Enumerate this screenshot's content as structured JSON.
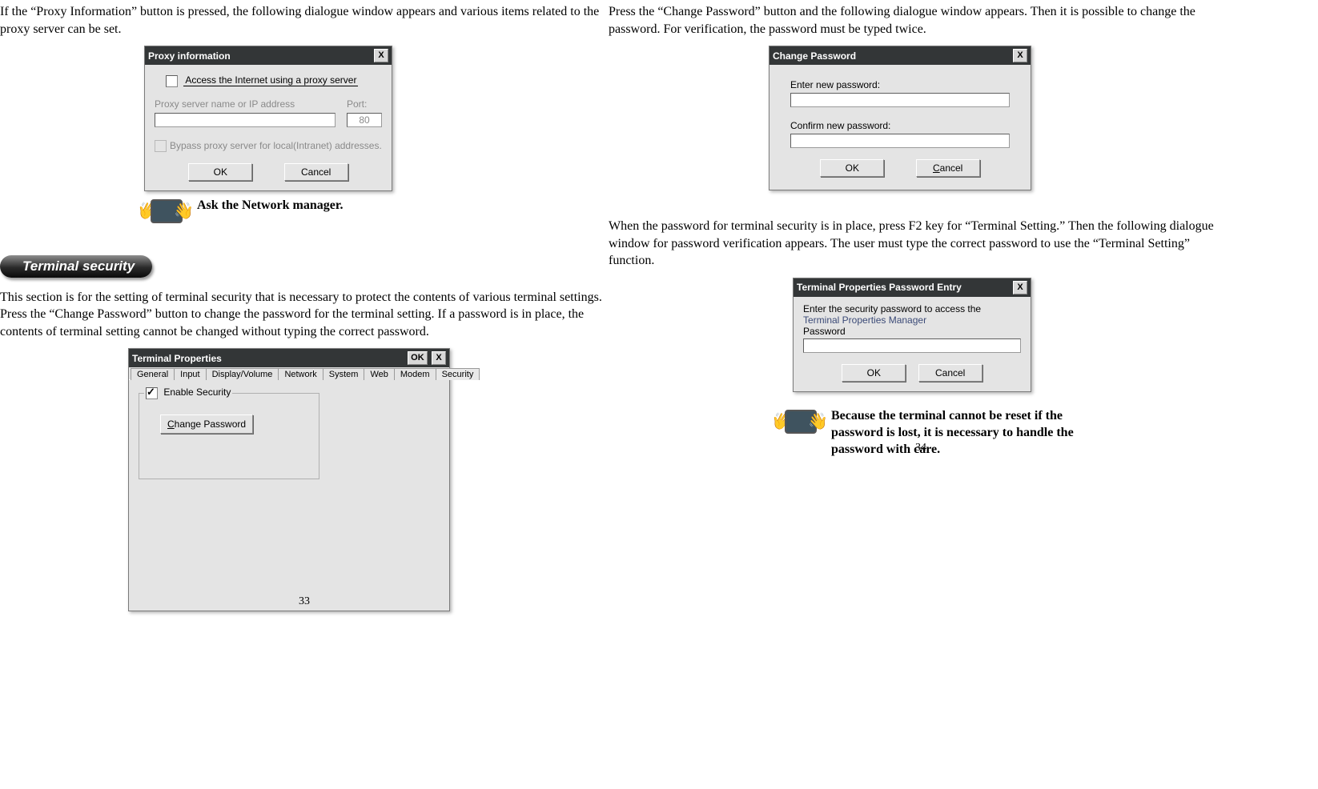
{
  "page_numbers": {
    "left": "33",
    "right": "34"
  },
  "left": {
    "intro": "If the “Proxy Information” button is pressed, the following dialogue window appears and various items related to the proxy server can be set.",
    "proxy_dialog": {
      "title": "Proxy information",
      "chk_label": "Access the Internet using a proxy server",
      "name_label": "Proxy server name or IP address",
      "port_label": "Port:",
      "port_value": "80",
      "bypass_label": "Bypass proxy server for local(Intranet) addresses.",
      "ok": "OK",
      "cancel": "Cancel"
    },
    "ask_note": "Ask the Network manager.",
    "section_heading": "Terminal security",
    "section_body": "This section is for the setting of terminal security that is necessary to protect the contents of various terminal settings. Press the “Change Password” button to change the password for the terminal setting. If a password is in place, the contents of terminal setting cannot be changed without typing the correct password.",
    "term_props": {
      "title": "Terminal Properties",
      "ok_mini": "OK",
      "tabs": [
        "General",
        "Input",
        "Display/Volume",
        "Network",
        "System",
        "Web",
        "Modem",
        "Security"
      ],
      "enable_label": "Enable Security",
      "change_pw_prefix": "C",
      "change_pw_rest": "hange Password"
    }
  },
  "right": {
    "intro": "Press the “Change Password” button and the following dialogue window appears. Then it is possible to change the password. For verification, the password must be typed twice.",
    "change_pw_dialog": {
      "title": "Change Password",
      "enter_label": "Enter new password:",
      "confirm_label": "Confirm new password:",
      "ok": "OK",
      "cancel_prefix": "C",
      "cancel_rest": "ancel"
    },
    "mid_para": "When the password for terminal security is in place, press F2 key for “Terminal Setting.” Then the following dialogue window for password verification appears. The user must type the correct password to use the “Terminal Setting” function.",
    "pw_entry_dialog": {
      "title": "Terminal Properties Password Entry",
      "line1": "Enter the security password to access the",
      "line2": "Terminal Properties Manager",
      "line3": "Password",
      "ok": "OK",
      "cancel": "Cancel"
    },
    "warn_note": "Because the terminal cannot be reset if the password is lost, it is necessary to handle the password with care."
  }
}
